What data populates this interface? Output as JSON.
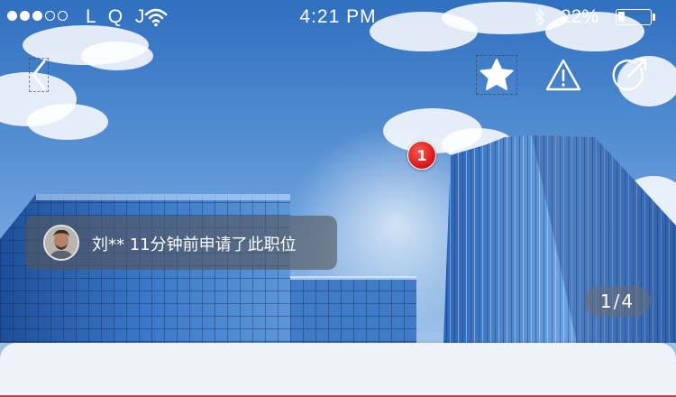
{
  "status_bar": {
    "carrier": "L Q J",
    "time": "4:21 PM",
    "battery_percent": "22%",
    "battery_level": 0.22,
    "signal_bars_filled": 3,
    "signal_bars_total": 5
  },
  "header": {
    "back_icon": "chevron-left-icon",
    "favorite_icon": "star-icon",
    "report_icon": "warning-triangle-icon",
    "share_icon": "share-arrow-icon"
  },
  "notification_badge": {
    "count": "1"
  },
  "applicant_toast": {
    "text": "刘** 11分钟前申请了此职位"
  },
  "gallery": {
    "page_indicator": "1/4"
  },
  "colors": {
    "sky": "#3a78c3",
    "badge": "#d3131a",
    "accent_line": "#e03a3a",
    "sheet": "#eef2f9"
  }
}
